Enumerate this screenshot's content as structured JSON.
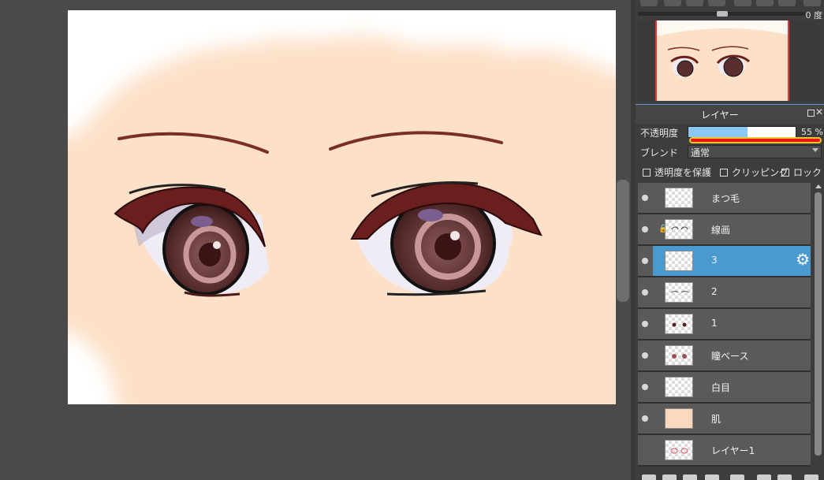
{
  "navigator": {
    "rotation_value": "0 度"
  },
  "layer_panel": {
    "title": "レイヤー",
    "opacity_label": "不透明度",
    "opacity_value": "55 %",
    "opacity_fraction": 0.55,
    "blend_label": "ブレンド",
    "blend_value": "通常",
    "checkboxes": [
      "透明度を保護",
      "クリッピング",
      "ロック"
    ],
    "layers": [
      {
        "name": "まつ毛",
        "selected": false,
        "visible": true,
        "locked": false
      },
      {
        "name": "線画",
        "selected": false,
        "visible": true,
        "locked": true
      },
      {
        "name": "3",
        "selected": true,
        "visible": true,
        "locked": false
      },
      {
        "name": "2",
        "selected": false,
        "visible": true,
        "locked": false
      },
      {
        "name": "1",
        "selected": false,
        "visible": true,
        "locked": false
      },
      {
        "name": "瞳ベース",
        "selected": false,
        "visible": true,
        "locked": false
      },
      {
        "name": "白目",
        "selected": false,
        "visible": true,
        "locked": false
      },
      {
        "name": "肌",
        "selected": false,
        "visible": true,
        "locked": false
      },
      {
        "name": "レイヤー1",
        "selected": false,
        "visible": false,
        "locked": false
      }
    ]
  },
  "colors": {
    "skin": "#fde0c8",
    "selection": "#4a9ad0",
    "opacity_fill": "#8cc8f4",
    "highlight": "#f4c330"
  }
}
